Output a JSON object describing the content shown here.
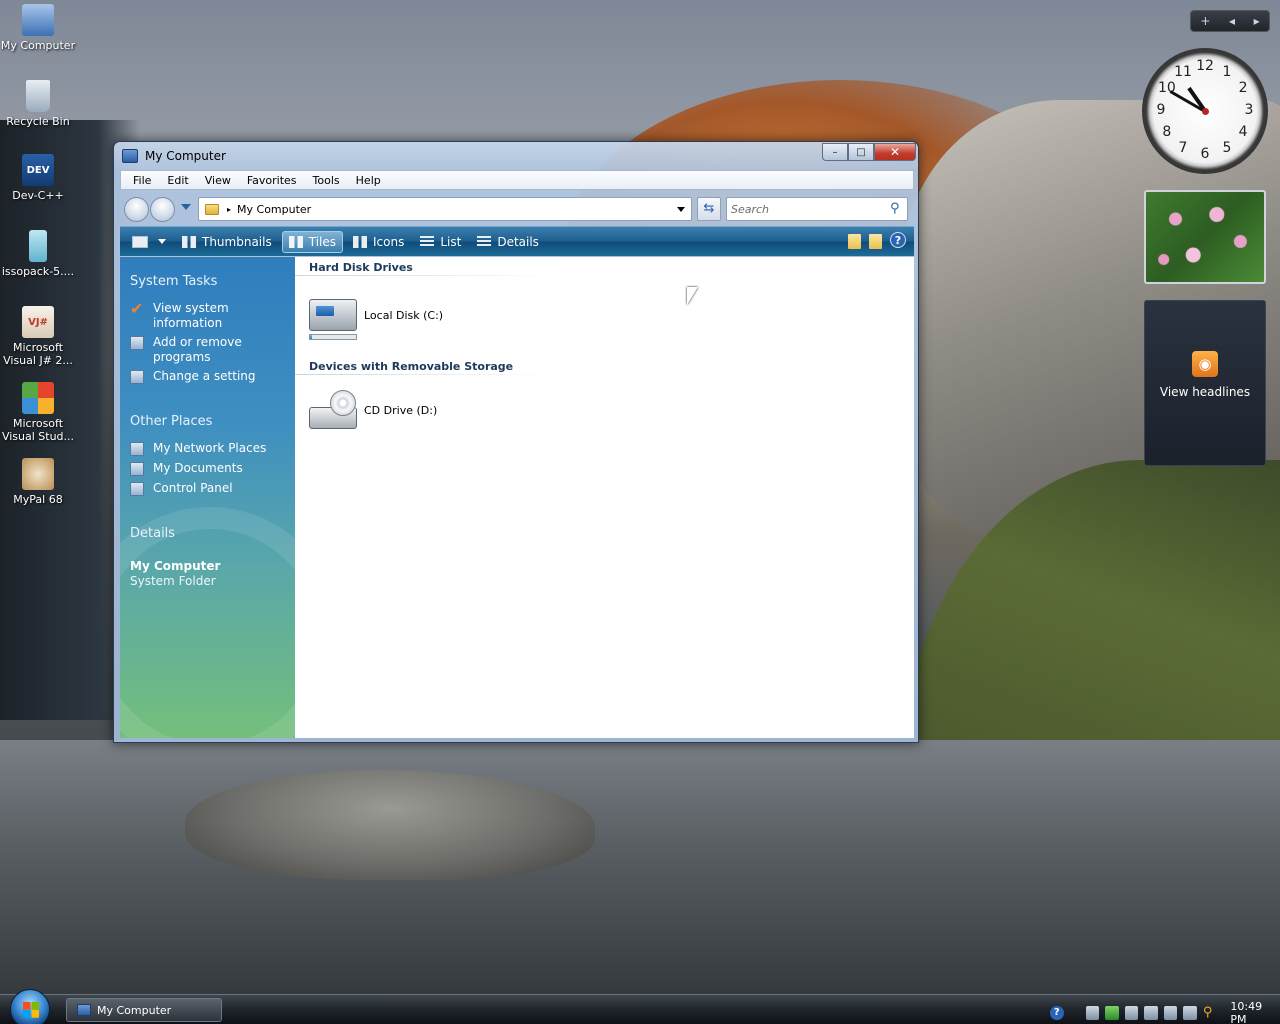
{
  "desktop": {
    "icons": [
      {
        "label": "My Computer",
        "icon": "computer-icon"
      },
      {
        "label": "Recycle Bin",
        "icon": "recycle-bin-icon"
      },
      {
        "label": "Dev-C++",
        "icon": "devcpp-icon",
        "badge": "DEV"
      },
      {
        "label": "issopack-5....",
        "icon": "issopack-icon"
      },
      {
        "label": "Microsoft Visual J# 2...",
        "icon": "visual-jsharp-icon",
        "badge": "VJ#"
      },
      {
        "label": "Microsoft Visual Stud...",
        "icon": "visual-studio-icon"
      },
      {
        "label": "MyPal 68",
        "icon": "mypal-icon"
      }
    ]
  },
  "sidebar_gadgets": {
    "controls": {
      "add": "+",
      "prev": "◂",
      "next": "▸"
    },
    "clock": {
      "numbers": [
        "12",
        "1",
        "2",
        "3",
        "4",
        "5",
        "6",
        "7",
        "8",
        "9",
        "10",
        "11"
      ],
      "hour": 10,
      "minute": 50
    },
    "feed": {
      "label": "View headlines",
      "icon": "rss-icon"
    }
  },
  "window": {
    "title": "My Computer",
    "buttons": {
      "minimize": "–",
      "maximize": "□",
      "close": "✕"
    },
    "menu": [
      "File",
      "Edit",
      "View",
      "Favorites",
      "Tools",
      "Help"
    ],
    "address": {
      "path": "My Computer",
      "separator": "▸"
    },
    "refresh_icon": "⇆",
    "search": {
      "placeholder": "Search",
      "icon": "⚲"
    },
    "toolbar": {
      "views": [
        "Thumbnails",
        "Tiles",
        "Icons",
        "List",
        "Details"
      ],
      "active_view": "Tiles",
      "help": "?"
    },
    "task_pane": {
      "system_tasks": {
        "heading": "System Tasks",
        "items": [
          {
            "label": "View system information",
            "line1": "View system",
            "line2": "information",
            "icon": "checkmark-icon"
          },
          {
            "label": "Add or remove programs",
            "line1": "Add or remove",
            "line2": "programs",
            "icon": "programs-icon"
          },
          {
            "label": "Change a setting",
            "line1": "Change a setting",
            "line2": "",
            "icon": "control-panel-icon"
          }
        ]
      },
      "other_places": {
        "heading": "Other Places",
        "items": [
          {
            "label": "My Network Places",
            "icon": "network-icon"
          },
          {
            "label": "My Documents",
            "icon": "documents-icon"
          },
          {
            "label": "Control Panel",
            "icon": "control-panel-icon"
          }
        ]
      },
      "details": {
        "heading": "Details",
        "name": "My Computer",
        "type": "System Folder"
      }
    },
    "content": {
      "groups": [
        {
          "heading": "Hard Disk Drives",
          "items": [
            {
              "label": "Local Disk (C:)",
              "icon": "hard-disk-icon",
              "usage_fraction": 0.04
            }
          ]
        },
        {
          "heading": "Devices with Removable Storage",
          "items": [
            {
              "label": "CD Drive (D:)",
              "icon": "cd-drive-icon"
            }
          ]
        }
      ]
    }
  },
  "taskbar": {
    "task_button": "My Computer",
    "tray": {
      "help": "?",
      "time": "10:49 PM"
    }
  }
}
